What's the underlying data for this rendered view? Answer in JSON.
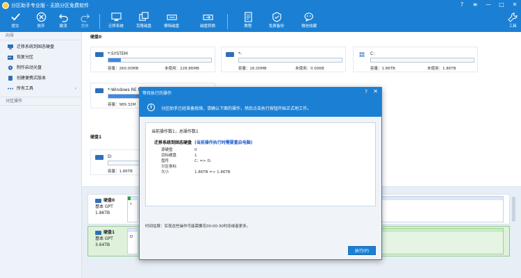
{
  "window": {
    "title": "分区助手专业版 - 无损分区免费软件",
    "controls": {
      "help": "?",
      "menu": "≡",
      "minimize": "—",
      "maximize": "□",
      "close": "✕"
    }
  },
  "toolbar": {
    "commit": "提交",
    "discard": "放弃",
    "undo": "撤消",
    "redo": "重做",
    "migrate_os": "迁移系统",
    "clone_disk": "克隆磁盘",
    "wipe_disk": "擦除磁盘",
    "disk_convert": "磁盘转换",
    "tutorial": "教程",
    "free_backup": "免费备份",
    "wechat": "微信收藏",
    "tools": "工具"
  },
  "sidebar": {
    "wizard_header": "向导",
    "items": [
      {
        "label": "迁移系统到固态硬盘",
        "icon": "migrate-icon"
      },
      {
        "label": "恢复分区",
        "icon": "recover-icon"
      },
      {
        "label": "制作启动光盘",
        "icon": "boot-disc-icon"
      },
      {
        "label": "创建便携式版本",
        "icon": "portable-icon"
      },
      {
        "label": "所有工具",
        "icon": "tools-icon",
        "arrow": "›"
      }
    ],
    "partition_ops_header": "分区操作"
  },
  "disks": [
    {
      "heading": "硬盘0",
      "partitions": [
        {
          "name": "*:SYSTEM",
          "capacity": "容量：260.00MB",
          "free": "未使用：228.86MB",
          "fill": 0.12
        },
        {
          "name": "*:",
          "capacity": "容量：16.00MB",
          "free": "未使用：0.00KB",
          "fill": 0
        },
        {
          "name": "C:",
          "capacity": "容量：1.86TB",
          "free": "未使用：1.86TB",
          "fill": 0
        },
        {
          "name": "*:Windows RE to",
          "capacity": "容量：989.32M",
          "free": "",
          "fill": 0.55
        }
      ]
    },
    {
      "heading": "硬盘1",
      "partitions": [
        {
          "name": "D:",
          "capacity": "容量：1.86TB",
          "free": "",
          "fill": 0
        }
      ]
    }
  ],
  "disk_map": [
    {
      "name": "硬盘0",
      "type": "基本 GPT",
      "size": "1.86TB",
      "part1_label": "*",
      "part2_label": "S",
      "part1_fill": 0.3
    },
    {
      "name": "硬盘1",
      "type": "基本 GPT",
      "size": "3.64TB",
      "part1_label": "D",
      "part2_label": "D",
      "part1_fill": 0
    }
  ],
  "dialog": {
    "title": "等待执行的操作",
    "help": "?",
    "close": "✕",
    "info_icon": "i",
    "banner": "分区助手已经准备就绪，请确认下面的操作，然后点击执行按钮开始正式地工作。",
    "op_count": "当前操作数1，总操作数1",
    "op_name": "迁移系统到固态硬盘",
    "op_warning": "(当前操作执行时需要重启电脑)",
    "rows": [
      {
        "key": "源硬盘",
        "value": "0"
      },
      {
        "key": "目标硬盘",
        "value": "1"
      },
      {
        "key": "盘符",
        "value": "C: => D:"
      },
      {
        "key": "分区卷标",
        "value": ""
      },
      {
        "key": "大小",
        "value": "1.86TB => 1.86TB"
      }
    ],
    "time_estimate": "时间估算：实现这些操作可能需要花00:00:30时间或者更多。",
    "execute": "执行(P)"
  }
}
